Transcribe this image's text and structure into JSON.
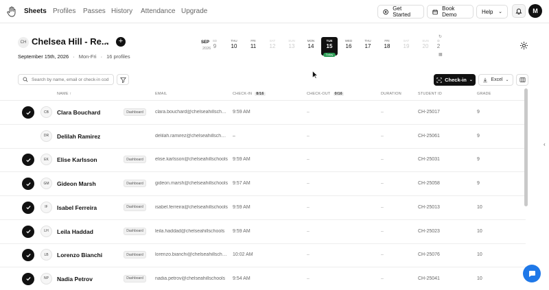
{
  "nav": {
    "items": [
      {
        "label": "Sheets",
        "active": true
      },
      {
        "label": "Profiles",
        "active": false
      },
      {
        "label": "Passes",
        "active": false
      },
      {
        "label": "History",
        "active": false
      },
      {
        "label": "Attendance",
        "active": false
      },
      {
        "label": "Upgrade",
        "active": false
      }
    ],
    "get_started": "Get Started",
    "book_demo": "Book Demo",
    "help": "Help",
    "avatar_initial": "M"
  },
  "sheet": {
    "badge": "CH",
    "title": "Chelsea Hill - Re...",
    "date": "September 15th, 2026",
    "schedule": "Mon-Fri",
    "profiles": "16 profiles"
  },
  "calendar": {
    "month": "SEP",
    "year": "2026",
    "days": [
      {
        "dow": "SD",
        "num": "9"
      },
      {
        "dow": "THU",
        "num": "10"
      },
      {
        "dow": "FRI",
        "num": "11"
      },
      {
        "dow": "SAT",
        "num": "12"
      },
      {
        "dow": "SUN",
        "num": "13"
      },
      {
        "dow": "MON",
        "num": "14"
      },
      {
        "dow": "TUE",
        "num": "15"
      },
      {
        "dow": "WED",
        "num": "16"
      },
      {
        "dow": "THU",
        "num": "17"
      },
      {
        "dow": "FRI",
        "num": "18"
      },
      {
        "dow": "SAT",
        "num": "19"
      },
      {
        "dow": "SUN",
        "num": "20"
      },
      {
        "dow": "D",
        "num": "2"
      }
    ],
    "today_label": "Today"
  },
  "toolbar": {
    "search_placeholder": "Search by name, email or check-in code",
    "checkin_label": "Check-in",
    "excel_label": "Excel"
  },
  "table": {
    "headers": {
      "name": "NAME ↑",
      "email": "EMAIL",
      "checkin": "CHECK-IN",
      "checkin_count": "8/16",
      "checkout": "CHECK-OUT",
      "checkout_count": "0/16",
      "duration": "DURATION",
      "student_id": "STUDENT ID",
      "grade": "GRADE"
    },
    "rows": [
      {
        "initials": "CB",
        "name": "Clara Bouchard",
        "badge": "Dashboard",
        "email": "clara.bouchard@chelseahillschools",
        "checkin": "9:59 AM",
        "checkout": "–",
        "duration": "–",
        "student_id": "CH-25017",
        "grade": "9"
      },
      {
        "initials": "DR",
        "name": "Delilah Ramirez",
        "badge": "",
        "email": "delilah.ramirez@chelseahillschools",
        "checkin": "–",
        "checkout": "–",
        "duration": "–",
        "student_id": "CH-25061",
        "grade": "9"
      },
      {
        "initials": "EK",
        "name": "Elise Karlsson",
        "badge": "Dashboard",
        "email": "elise.karlsson@chelseahillschools",
        "checkin": "9:59 AM",
        "checkout": "–",
        "duration": "–",
        "student_id": "CH-25031",
        "grade": "9"
      },
      {
        "initials": "GM",
        "name": "Gideon Marsh",
        "badge": "Dashboard",
        "email": "gideon.marsh@chelseahillschools",
        "checkin": "9:57 AM",
        "checkout": "–",
        "duration": "–",
        "student_id": "CH-25058",
        "grade": "9"
      },
      {
        "initials": "IF",
        "name": "Isabel Ferreira",
        "badge": "Dashboard",
        "email": "isabel.ferreira@chelseahillschools",
        "checkin": "9:59 AM",
        "checkout": "–",
        "duration": "–",
        "student_id": "CH-25013",
        "grade": "10"
      },
      {
        "initials": "LH",
        "name": "Leila Haddad",
        "badge": "Dashboard",
        "email": "leila.haddad@chelseahillschools",
        "checkin": "9:59 AM",
        "checkout": "–",
        "duration": "–",
        "student_id": "CH-25023",
        "grade": "10"
      },
      {
        "initials": "LB",
        "name": "Lorenzo Bianchi",
        "badge": "Dashboard",
        "email": "lorenzo.bianchi@chelseahillschools",
        "checkin": "10:02 AM",
        "checkout": "–",
        "duration": "–",
        "student_id": "CH-25076",
        "grade": "10"
      },
      {
        "initials": "NP",
        "name": "Nadia Petrov",
        "badge": "Dashboard",
        "email": "nadia.petrov@chelseahillschools",
        "checkin": "9:54 AM",
        "checkout": "–",
        "duration": "–",
        "student_id": "CH-25041",
        "grade": "10"
      }
    ]
  },
  "colors": {
    "accent": "#111111",
    "today_green": "#2e9d57",
    "chat_blue": "#1f78e8"
  },
  "icons": [
    "hand-logo-icon",
    "get-started-icon",
    "calendar-icon",
    "chevron-down-icon",
    "bell-icon",
    "plus-icon",
    "settings-gear-icon",
    "search-icon",
    "filter-icon",
    "qr-scan-icon",
    "download-icon",
    "columns-icon",
    "check-icon",
    "chat-icon"
  ]
}
